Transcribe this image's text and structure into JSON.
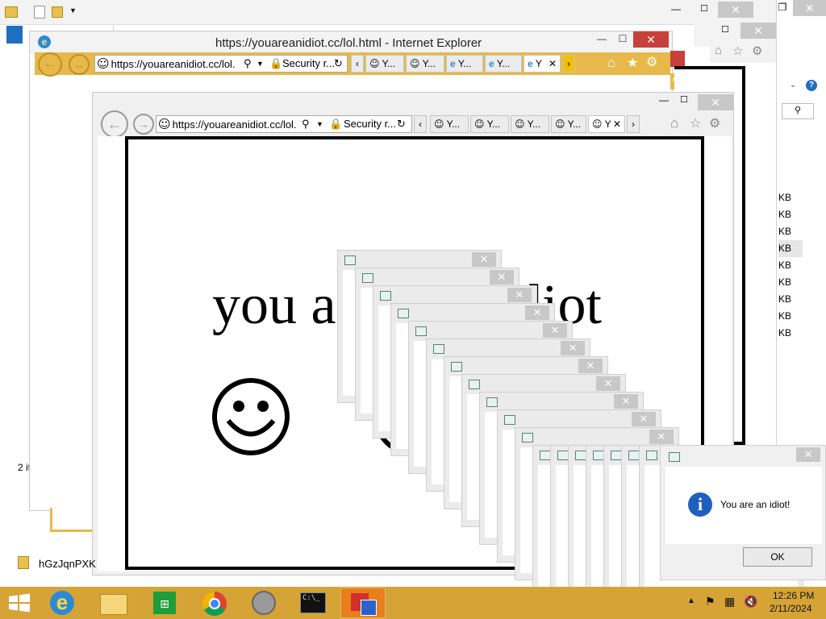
{
  "desktop": {
    "explorer": {
      "items_count": "2 it",
      "file_name": "hGzJqnPXK",
      "size_units": [
        "KB",
        "KB",
        "KB",
        "KB",
        "KB",
        "KB",
        "KB",
        "KB",
        "KB"
      ]
    }
  },
  "ie_back": {
    "title": "https://youareanidiot.cc/lol.html - Internet Explorer",
    "address": "https://youareanidiot.cc/lol.",
    "security": "Security r...",
    "tabs": [
      "Y...",
      "Y...",
      "Y...",
      "Y...",
      "Y"
    ]
  },
  "ie_front": {
    "address": "https://youareanidiot.cc/lol.",
    "security": "Security r...",
    "tabs": [
      "Y...",
      "Y...",
      "Y...",
      "Y...",
      "Y"
    ]
  },
  "page": {
    "headline": "you a",
    "headline_tail": "diot"
  },
  "dialog": {
    "message": "You are an idiot!",
    "ok_label": "OK"
  },
  "taskbar": {
    "time": "12:26 PM",
    "date": "2/11/2024",
    "accent": "#d6a336"
  }
}
